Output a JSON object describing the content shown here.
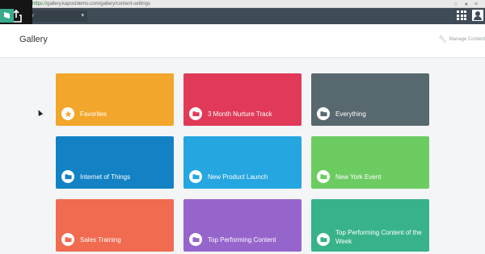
{
  "browser": {
    "url_scheme": "https://",
    "url_rest": "gallery.kapostdemo.com/gallery/content-settings"
  },
  "nav": {
    "dropdown_label": "ery"
  },
  "header": {
    "title": "Gallery",
    "manage_label": "Manage Content"
  },
  "tiles": [
    {
      "label": "Favorites",
      "color": "#f2a62b",
      "icon": "star-icon"
    },
    {
      "label": "3 Month Nurture Track",
      "color": "#e13a59",
      "icon": "folder-icon"
    },
    {
      "label": "Everything",
      "color": "#58686f",
      "icon": "folder-icon"
    },
    {
      "label": "Internet of Things",
      "color": "#1282c4",
      "icon": "folder-icon"
    },
    {
      "label": "New Product Launch",
      "color": "#25a6e0",
      "icon": "folder-icon"
    },
    {
      "label": "New York Event",
      "color": "#6ccc62",
      "icon": "folder-icon"
    },
    {
      "label": "Sales Training",
      "color": "#f06b4f",
      "icon": "folder-icon"
    },
    {
      "label": "Top Performing Content",
      "color": "#9665cc",
      "icon": "folder-icon"
    },
    {
      "label": "Top Performing Content of the Week",
      "color": "#38b28a",
      "icon": "folder-icon"
    }
  ]
}
